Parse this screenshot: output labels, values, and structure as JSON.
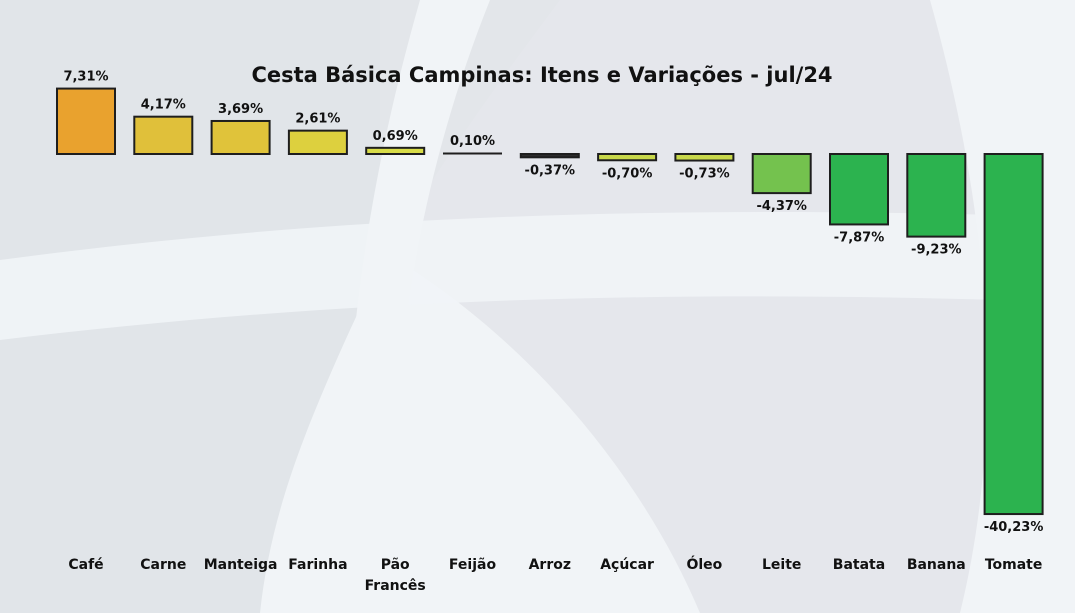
{
  "chart_data": {
    "type": "bar",
    "title": "Cesta Básica Campinas: Itens e Variações - jul/24",
    "xlabel": "",
    "ylabel": "",
    "ylim": [
      -40.23,
      7.31
    ],
    "grid": false,
    "legend": "none",
    "categories": [
      "Café",
      "Carne",
      "Manteiga",
      "Farinha",
      "Pão Francês",
      "Feijão",
      "Arroz",
      "Açúcar",
      "Óleo",
      "Leite",
      "Batata",
      "Banana",
      "Tomate"
    ],
    "category_lines": [
      [
        "Café"
      ],
      [
        "Carne"
      ],
      [
        "Manteiga"
      ],
      [
        "Farinha"
      ],
      [
        "Pão",
        "Francês"
      ],
      [
        "Feijão"
      ],
      [
        "Arroz"
      ],
      [
        "Açúcar"
      ],
      [
        "Óleo"
      ],
      [
        "Leite"
      ],
      [
        "Batata"
      ],
      [
        "Banana"
      ],
      [
        "Tomate"
      ]
    ],
    "values": [
      7.31,
      4.17,
      3.69,
      2.61,
      0.69,
      0.1,
      -0.37,
      -0.7,
      -0.73,
      -4.37,
      -7.87,
      -9.23,
      -40.23
    ],
    "data_labels": [
      "7,31%",
      "4,17%",
      "3,69%",
      "2,61%",
      "0,69%",
      "0,10%",
      "-0,37%",
      "-0,70%",
      "-0,73%",
      "-4,37%",
      "-7,87%",
      "-9,23%",
      "-40,23%"
    ],
    "colors": [
      "#e9a22e",
      "#e0c03a",
      "#e0c33a",
      "#ddd03e",
      "#d8dc48",
      "#d8dc48",
      "#2c2c2c",
      "#c8d84a",
      "#c8d84a",
      "#74c24e",
      "#2cb34f",
      "#2cb34f",
      "#2cb34f"
    ],
    "outline_color": "#1e1e1e"
  }
}
